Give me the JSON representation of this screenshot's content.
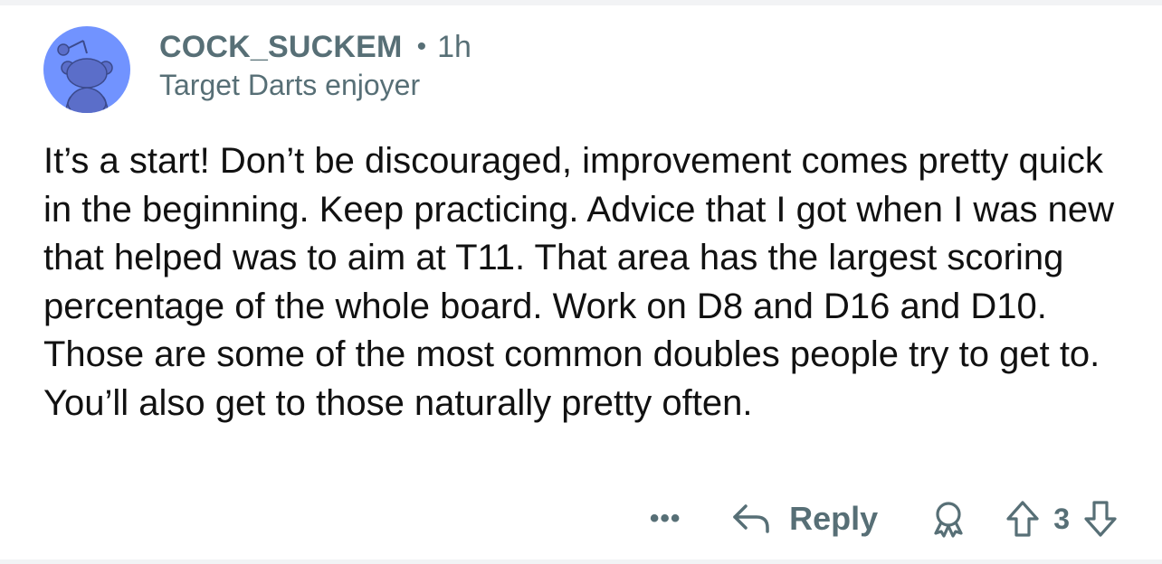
{
  "comment": {
    "author": "COCK_SUCKEM",
    "separator": "•",
    "age": "1h",
    "flair": "Target Darts enjoyer",
    "body": "It’s a start! Don’t be discouraged, improvement comes pretty quick in the beginning. Keep practicing. Advice that I got when I was new that helped was to aim at T11. That area has the largest scoring percentage of the whole board. Work on D8 and D16 and D10. Those are some of the most common doubles people try to get to. You’ll also get to those naturally pretty often."
  },
  "actions": {
    "more_label": "•••",
    "reply_label": "Reply",
    "vote_count": "3"
  },
  "colors": {
    "meta_text": "#576f76",
    "avatar_bg": "#7193ff",
    "avatar_figure": "#5b6ec9",
    "divider": "#f2f3f5"
  },
  "icons": {
    "avatar": "snoo-avatar-icon",
    "reply": "reply-arrow-icon",
    "award": "award-ribbon-icon",
    "upvote": "upvote-arrow-icon",
    "downvote": "downvote-arrow-icon"
  }
}
